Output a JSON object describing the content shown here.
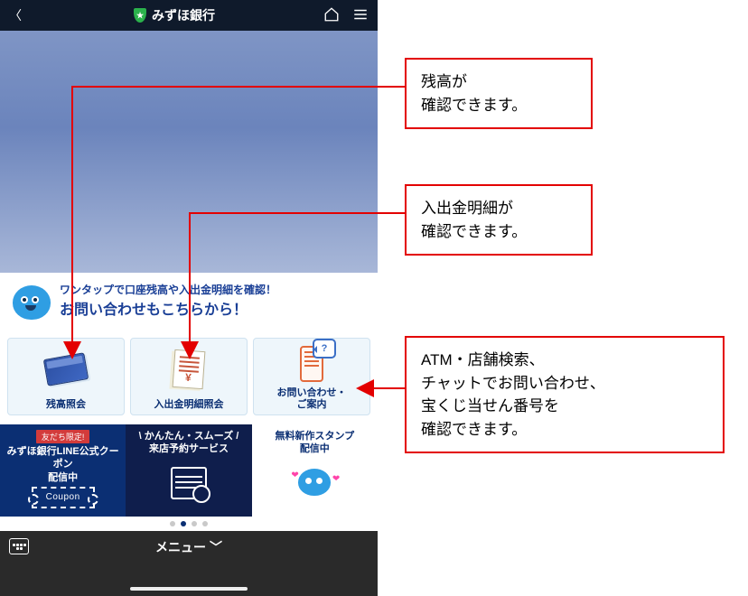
{
  "topbar": {
    "title": "みずほ銀行",
    "back_glyph": "〈"
  },
  "icons": {
    "shield_star": "★",
    "home": "home-icon",
    "hamburger": "hamburger-icon",
    "keyboard": "keyboard-icon",
    "caret_down": "﹀"
  },
  "prompt": {
    "line1": "ワンタップで口座残高や入出金明細を確認！",
    "line2": "お問い合わせもこちらから！"
  },
  "actions": [
    {
      "label": "残高照会"
    },
    {
      "label": "入出金明細照会"
    },
    {
      "label": "お問い合わせ・\nご案内"
    }
  ],
  "banners": [
    {
      "tag": "友だち限定!",
      "label": "みずほ銀行LINE公式クーポン\n配信中",
      "coupon_text": "Coupon"
    },
    {
      "label": "\\ かんたん・スムーズ /\n来店予約サービス"
    },
    {
      "label": "無料新作スタンプ\n配信中"
    }
  ],
  "bottombar": {
    "menu_label": "メニュー"
  },
  "callouts": {
    "c1": "残高が\n確認できます。",
    "c2": "入出金明細が\n確認できます。",
    "c3": "ATM・店舗検索、\nチャットでお問い合わせ、\n宝くじ当せん番号を\n確認できます。"
  },
  "contact_bubble": "?"
}
